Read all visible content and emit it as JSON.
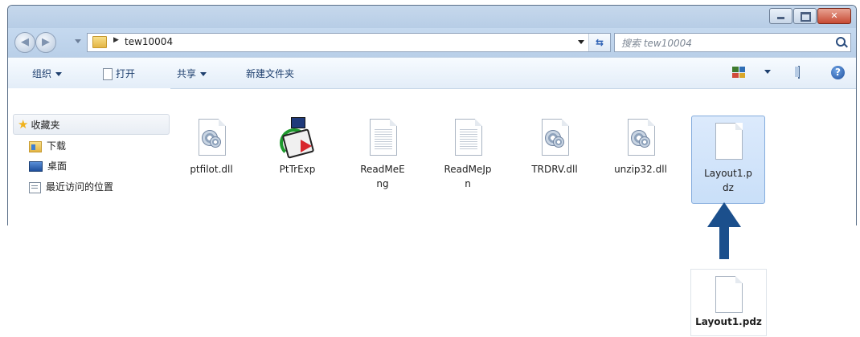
{
  "addressbar": {
    "path": "tew10004",
    "search_placeholder": "搜索 tew10004"
  },
  "toolbar": {
    "organize": "组织",
    "open": "打开",
    "share": "共享",
    "new_folder": "新建文件夹"
  },
  "sidebar": {
    "favorites": "收藏夹",
    "items": [
      {
        "label": "下载",
        "icon": "download-folder-icon"
      },
      {
        "label": "桌面",
        "icon": "desktop-icon"
      },
      {
        "label": "最近访问的位置",
        "icon": "recent-places-icon"
      }
    ]
  },
  "files": [
    {
      "name": "ptfilot.dll",
      "icon": "dll-gear-icon"
    },
    {
      "name": "PtTrExp",
      "icon": "exe-app-icon"
    },
    {
      "name": "ReadMeE\nng",
      "icon": "text-doc-icon"
    },
    {
      "name": "ReadMeJp\nn",
      "icon": "text-doc-icon"
    },
    {
      "name": "TRDRV.dll",
      "icon": "dll-gear-icon"
    },
    {
      "name": "unzip32.dll",
      "icon": "dll-gear-icon"
    },
    {
      "name": "Layout1.p\ndz",
      "icon": "blank-doc-icon",
      "selected": true
    }
  ],
  "callout": {
    "filename": "Layout1.pdz",
    "arrow_color": "#1b4f8c"
  },
  "colors": {
    "title_gradient_top": "#c6d8ec",
    "close_button": "#c74a33",
    "selection": "#c9dff8"
  }
}
